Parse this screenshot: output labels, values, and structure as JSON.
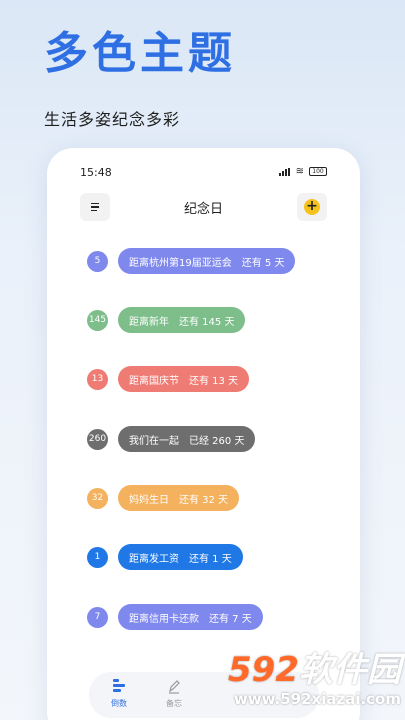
{
  "promo": {
    "title": "多色主题",
    "subtitle": "生活多姿纪念多彩"
  },
  "status_bar": {
    "time": "15:48",
    "battery": "100"
  },
  "app_bar": {
    "title": "纪念日",
    "menu_icon": "menu-icon",
    "add_icon": "add-icon"
  },
  "events": [
    {
      "count": "5",
      "name": "距离杭州第19届亚运会",
      "status": "还有 5 天",
      "color": "#7f88ec"
    },
    {
      "count": "145",
      "name": "距离新年",
      "status": "还有 145 天",
      "color": "#7dbe8a"
    },
    {
      "count": "13",
      "name": "距离国庆节",
      "status": "还有 13 天",
      "color": "#ee7c74"
    },
    {
      "count": "260",
      "name": "我们在一起",
      "status": "已经 260 天",
      "color": "#6e6e6e"
    },
    {
      "count": "32",
      "name": "妈妈生日",
      "status": "还有 32 天",
      "color": "#f4b15e"
    },
    {
      "count": "1",
      "name": "距离发工资",
      "status": "还有 1 天",
      "color": "#1f78e6"
    },
    {
      "count": "7",
      "name": "距离信用卡还款",
      "status": "还有 7 天",
      "color": "#7f88ec"
    }
  ],
  "bottom_nav": [
    {
      "label": "倒数",
      "icon": "countdown-icon",
      "active": true
    },
    {
      "label": "备忘",
      "icon": "pen-icon",
      "active": false
    }
  ],
  "watermark": {
    "number": "592",
    "text": "软件园",
    "url": "www.592xiazai.com"
  },
  "colors": {
    "accent": "#2f6fe4",
    "add_button": "#f5c21b"
  }
}
